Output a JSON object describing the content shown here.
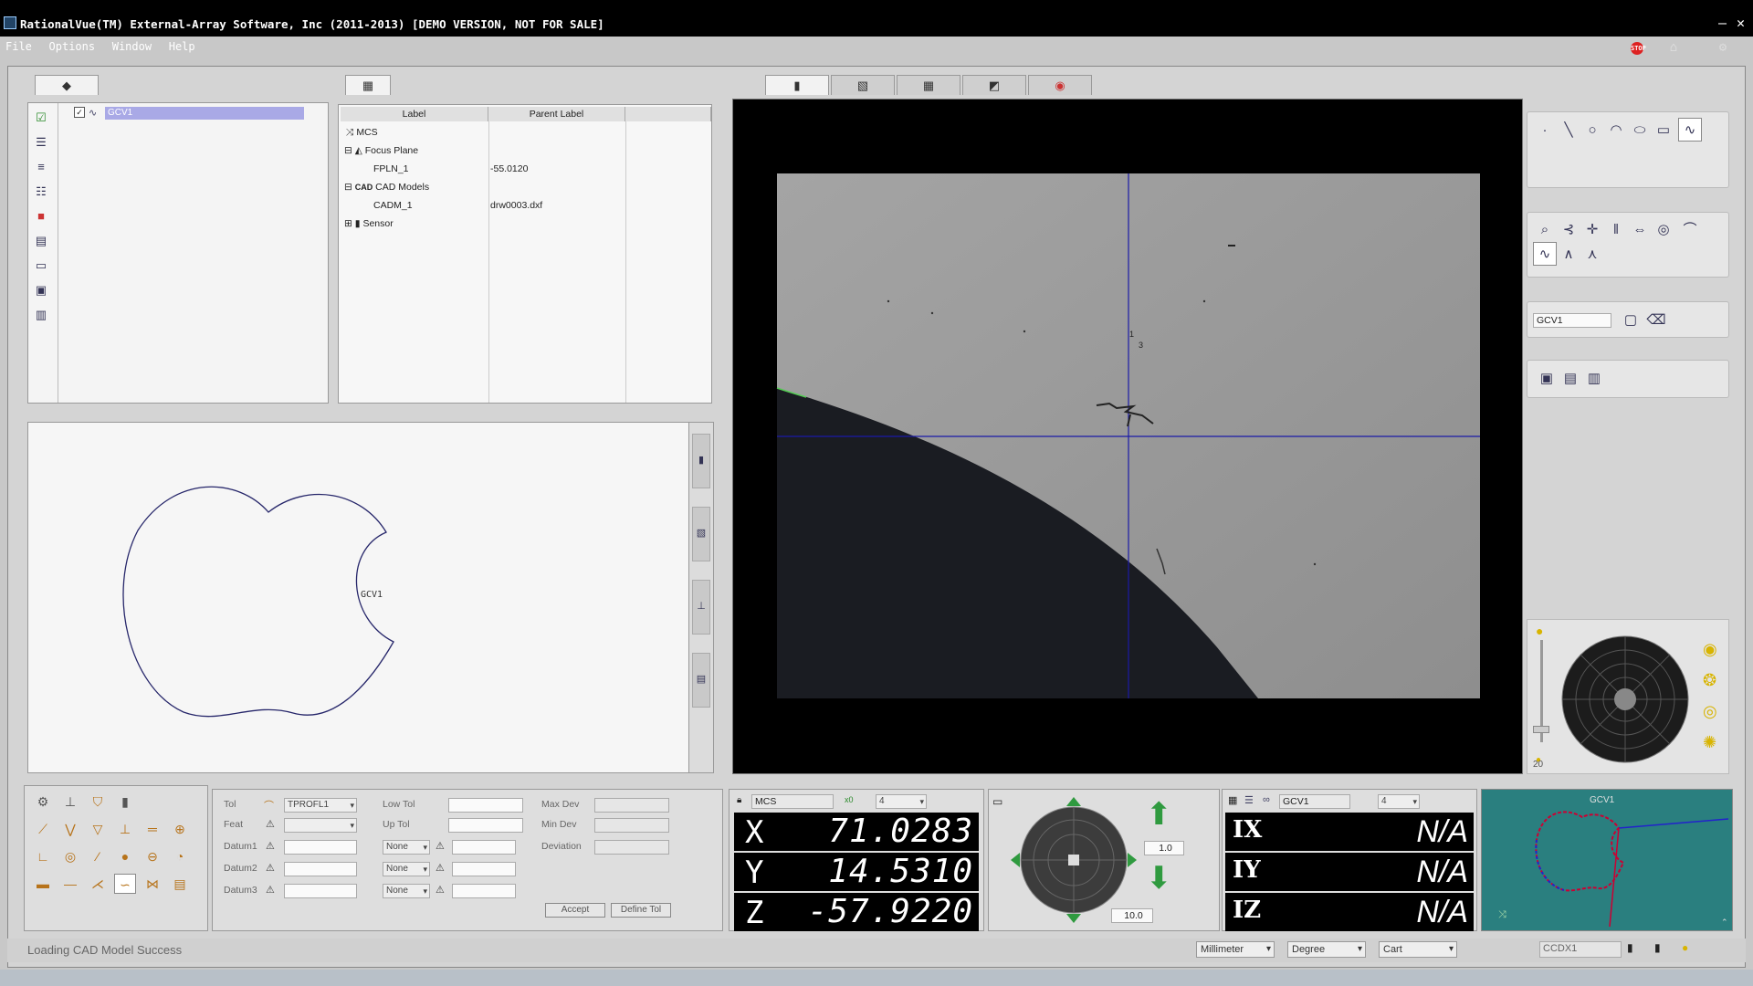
{
  "window": {
    "title": "RationalVue(TM) External-Array Software, Inc (2011-2013) [DEMO VERSION, NOT FOR SALE]",
    "minimize": "–",
    "close": "✕"
  },
  "menu": [
    "File",
    "Options",
    "Window",
    "Help"
  ],
  "feature_list": {
    "item_label": "GCV1"
  },
  "tree": {
    "headers": [
      "Label",
      "Parent Label"
    ],
    "rows": [
      {
        "label": "MCS",
        "parent": ""
      },
      {
        "label": "Focus Plane",
        "parent": ""
      },
      {
        "label": "FPLN_1",
        "parent": "-55.0120"
      },
      {
        "label": "CAD Models",
        "parent": ""
      },
      {
        "label": "CADM_1",
        "parent": "drw0003.dxf"
      },
      {
        "label": "Sensor",
        "parent": ""
      }
    ]
  },
  "cad_view": {
    "shape_label": "GCV1"
  },
  "camera": {
    "crosshair_label_top": "1",
    "crosshair_label_bottom": "3"
  },
  "right_tools": {
    "feature_name": "GCV1"
  },
  "light": {
    "slider_value": "20"
  },
  "tolerance": {
    "labels": {
      "tol": "Tol",
      "feat": "Feat",
      "datum1": "Datum1",
      "datum2": "Datum2",
      "datum3": "Datum3",
      "low_tol": "Low Tol",
      "up_tol": "Up Tol",
      "max_dev": "Max Dev",
      "min_dev": "Min Dev",
      "deviation": "Deviation"
    },
    "tol_type": "TPROFL1",
    "datum_opts": [
      "None",
      "None",
      "None"
    ],
    "accept": "Accept",
    "define_tol": "Define Tol"
  },
  "dro": {
    "coord_system": "MCS",
    "coord_icon": "x0",
    "precision": "4",
    "x": "71.0283",
    "y": "14.5310",
    "z": "-57.9220",
    "axis_x": "X",
    "axis_y": "Y",
    "axis_z": "Z"
  },
  "jog": {
    "step_small": "1.0",
    "step_large": "10.0"
  },
  "deviation_dro": {
    "feature": "GCV1",
    "precision": "4",
    "ix": "N/A",
    "iy": "N/A",
    "iz": "N/A",
    "label_x": "IX",
    "label_y": "IY",
    "label_z": "IZ"
  },
  "preview": {
    "label": "GCV1"
  },
  "status": {
    "message": "Loading CAD Model Success",
    "units": "Millimeter",
    "angle": "Degree",
    "coord": "Cart",
    "camera": "CCDX1"
  },
  "colors": {
    "selection": "#a9a9e6",
    "crosshair": "#1a1aa8",
    "dro_bg": "#000000",
    "arrow_green": "#2f9a3f"
  }
}
